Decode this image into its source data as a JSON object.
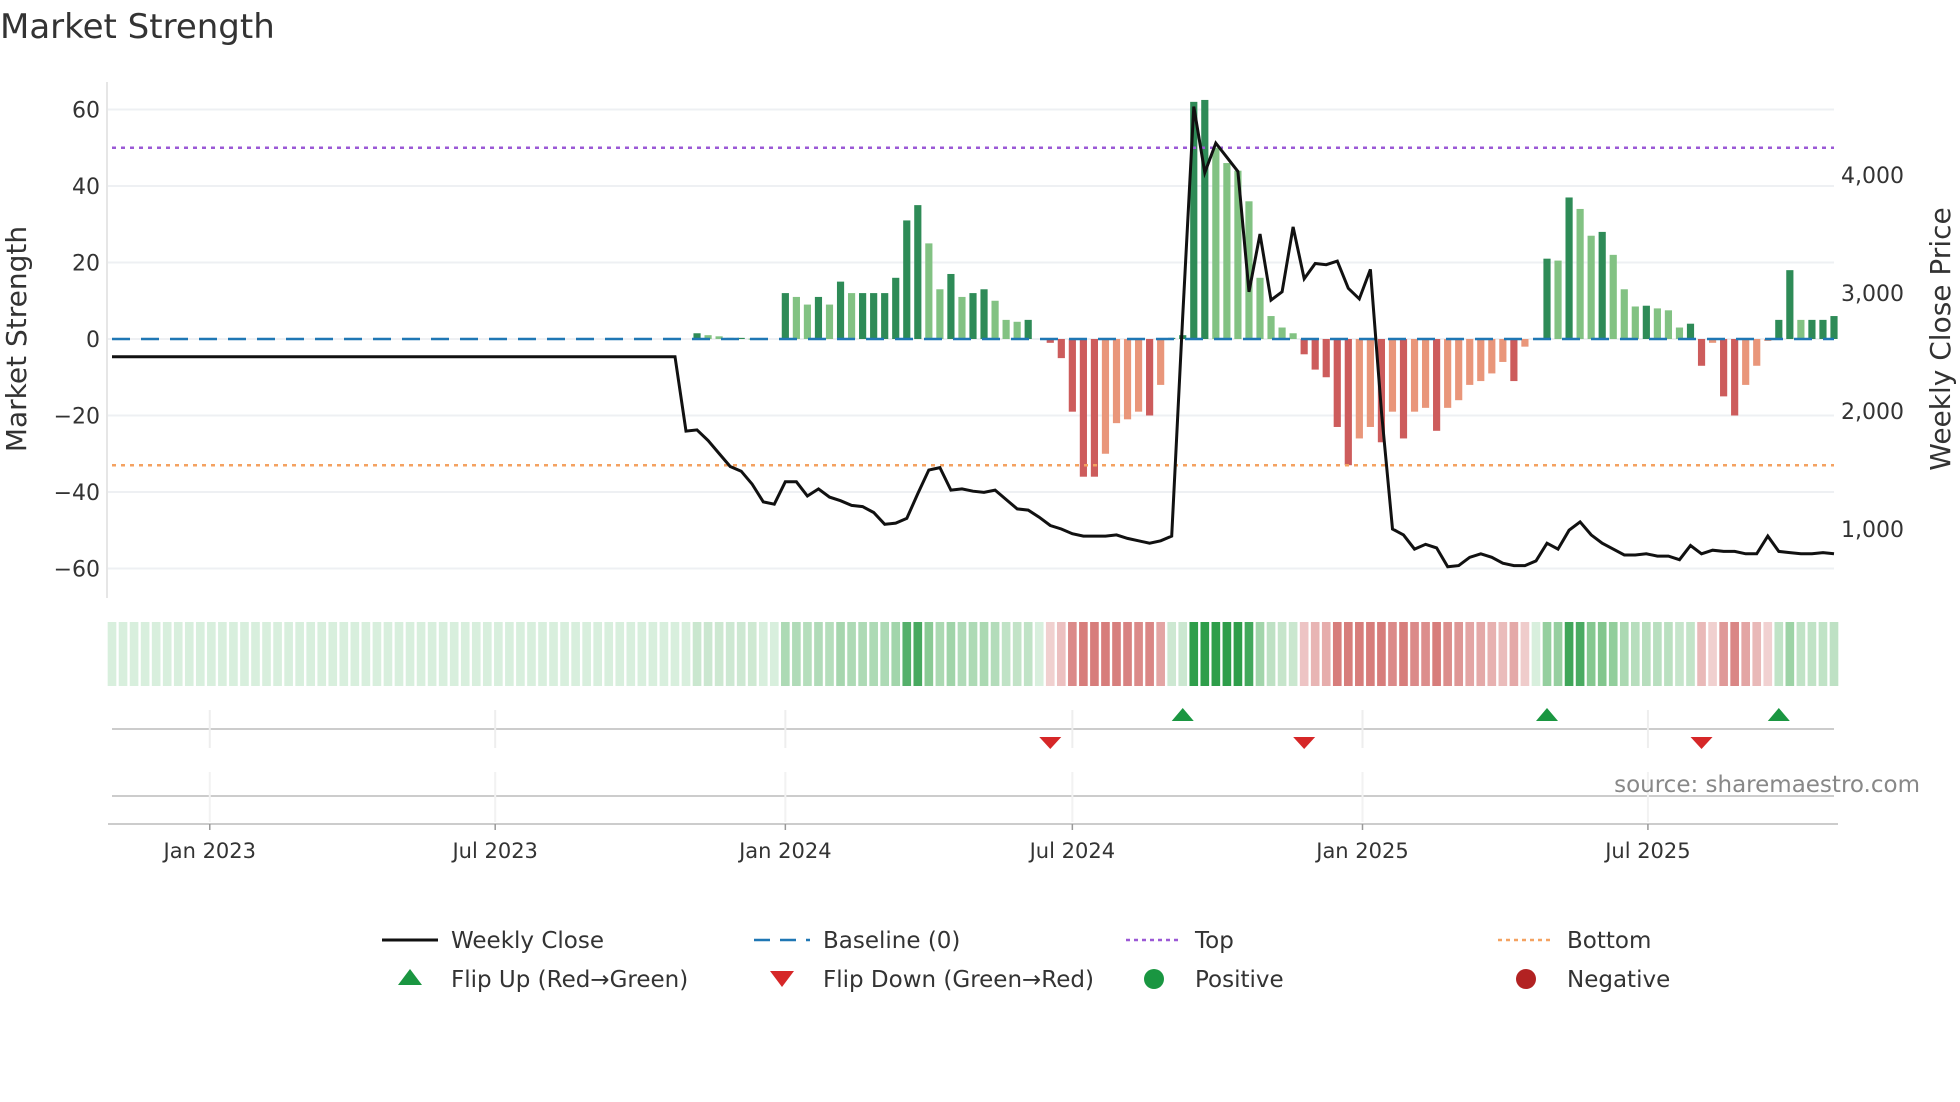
{
  "chart_data": {
    "type": "bar",
    "title": "Market Strength",
    "ylabel": "Market Strength",
    "y2label": "Weekly Close Price",
    "ylim": [
      -68,
      68
    ],
    "y2lim": [
      400,
      4700
    ],
    "yticks": [
      "60",
      "40",
      "20",
      "0",
      "−20",
      "−40",
      "−60"
    ],
    "ytick_values": [
      60,
      40,
      20,
      0,
      -20,
      -40,
      -60
    ],
    "y2ticks": [
      "4,000",
      "3,000",
      "2,000",
      "1,000"
    ],
    "y2tick_values": [
      4000,
      3000,
      2000,
      1000
    ],
    "xticks": [
      "Jan 2023",
      "Jul 2023",
      "Jan 2024",
      "Jul 2024",
      "Jan 2025",
      "Jul 2025"
    ],
    "xtick_dates": [
      "2023-01-01",
      "2023-07-01",
      "2024-01-01",
      "2024-07-01",
      "2025-01-01",
      "2025-07-01"
    ],
    "start_date": "2022-10-31",
    "interval_days": 7,
    "top_level": 50,
    "bottom_level": -33,
    "baseline": 0,
    "strength": [
      0,
      0,
      0,
      0,
      0,
      0,
      0,
      0,
      0,
      0,
      0,
      0,
      0,
      0,
      0,
      0,
      0,
      0,
      0,
      0,
      0,
      0,
      0,
      0,
      0,
      0,
      0,
      0,
      0,
      0,
      0,
      0,
      0,
      0,
      0,
      0,
      0,
      0,
      0,
      0,
      0,
      0,
      0,
      0,
      0,
      0,
      0,
      0,
      0,
      0,
      0,
      0,
      0,
      1.5,
      1,
      0.7,
      0.3,
      0.3,
      0.1,
      0,
      0,
      12,
      11,
      9,
      11,
      9,
      15,
      12,
      12,
      12,
      12,
      16,
      31,
      35,
      25,
      13,
      17,
      11,
      12,
      13,
      10,
      5,
      4.5,
      5,
      0,
      -1,
      -5,
      -19,
      -36,
      -36,
      -30,
      -22,
      -21,
      -19,
      -20,
      -12,
      0.3,
      1,
      62,
      62.5,
      50,
      46,
      44,
      36,
      16,
      6,
      3,
      1.5,
      -4,
      -8,
      -10,
      -23,
      -33,
      -26,
      -23,
      -27,
      -19,
      -26,
      -19,
      -18,
      -24,
      -18,
      -16,
      -12,
      -11,
      -9,
      -6,
      -11,
      -2,
      0,
      21,
      20.5,
      37,
      34,
      27,
      28,
      22,
      13,
      8.5,
      8.7,
      8,
      7.5,
      3,
      4,
      -7,
      -1,
      -15,
      -20,
      -12,
      -7,
      -0.5,
      5,
      18,
      5,
      5,
      5,
      6
    ],
    "weekly_close": [
      2460,
      2460,
      2460,
      2460,
      2460,
      2460,
      2460,
      2460,
      2460,
      2460,
      2460,
      2460,
      2460,
      2460,
      2460,
      2460,
      2460,
      2460,
      2460,
      2460,
      2460,
      2460,
      2460,
      2460,
      2460,
      2460,
      2460,
      2460,
      2460,
      2460,
      2460,
      2460,
      2460,
      2460,
      2460,
      2460,
      2460,
      2460,
      2460,
      2460,
      2460,
      2460,
      2460,
      2460,
      2460,
      2460,
      2460,
      2460,
      2460,
      2460,
      2460,
      2460,
      1830,
      1840,
      1750,
      1640,
      1530,
      1490,
      1380,
      1230,
      1210,
      1400,
      1400,
      1280,
      1340,
      1270,
      1240,
      1200,
      1190,
      1140,
      1040,
      1050,
      1090,
      1300,
      1500,
      1520,
      1330,
      1340,
      1320,
      1310,
      1330,
      1250,
      1170,
      1160,
      1100,
      1030,
      1000,
      960,
      940,
      940,
      940,
      950,
      920,
      900,
      880,
      900,
      940,
      2800,
      4580,
      4020,
      4270,
      4150,
      4030,
      3010,
      3500,
      2940,
      3010,
      3560,
      3120,
      3250,
      3240,
      3270,
      3040,
      2950,
      3200,
      2000,
      1000,
      950,
      830,
      870,
      840,
      680,
      690,
      760,
      790,
      760,
      710,
      690,
      690,
      730,
      880,
      830,
      990,
      1060,
      950,
      880,
      830,
      780,
      780,
      790,
      770,
      770,
      740,
      860,
      790,
      820,
      810,
      810,
      790,
      790,
      940,
      810,
      800,
      790,
      790,
      800,
      790
    ],
    "flips_up": [
      "2024-09-09",
      "2025-04-28",
      "2025-09-22"
    ],
    "flips_down": [
      "2024-06-17",
      "2024-11-25",
      "2025-08-04"
    ],
    "legend": [
      {
        "label": "Weekly Close",
        "kind": "line",
        "color": "#111111"
      },
      {
        "label": "Baseline (0)",
        "kind": "dash",
        "color": "#1f77b4"
      },
      {
        "label": "Top",
        "kind": "dot",
        "color": "#9b59d6"
      },
      {
        "label": "Bottom",
        "kind": "dot",
        "color": "#f4a261"
      },
      {
        "label": "Flip Up (Red→Green)",
        "kind": "tri-up",
        "color": "#1a9641"
      },
      {
        "label": "Flip Down (Green→Red)",
        "kind": "tri-down",
        "color": "#d62728"
      },
      {
        "label": "Positive",
        "kind": "circle",
        "color": "#1a9641"
      },
      {
        "label": "Negative",
        "kind": "circle",
        "color": "#b22222"
      }
    ],
    "legend_placement": "bottom",
    "source": "source: sharemaestro.com"
  },
  "colors": {
    "pos_up": "#2e8b57",
    "pos_down": "#82c283",
    "neg_down": "#cd5c5c",
    "neg_up": "#e9967a"
  }
}
